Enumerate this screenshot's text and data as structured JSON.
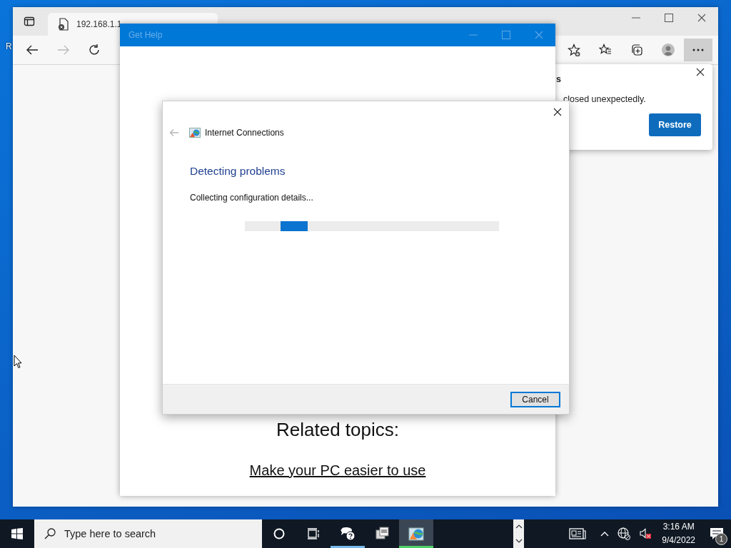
{
  "desktop": {
    "icon_labels": [
      "R"
    ]
  },
  "browser": {
    "tabs": [
      {
        "label": "192.168.1.1",
        "selected": true
      }
    ],
    "forward_disabled": true,
    "restore_popup": {
      "title": "s",
      "message": "closed unexpectedly.",
      "button": "Restore"
    }
  },
  "get_help": {
    "title": "Get Help",
    "heading": "Related topics:",
    "links": [
      "Make your PC easier to use"
    ]
  },
  "troubleshooter": {
    "title": "Internet Connections",
    "back_disabled": true,
    "heading": "Detecting problems",
    "status": "Collecting configuration details...",
    "progress": {
      "indeterminate": true
    },
    "buttons": [
      {
        "label": "Cancel",
        "default": true
      }
    ]
  },
  "taskbar": {
    "search": {
      "placeholder": "Type here to search"
    },
    "apps": [
      {
        "kind": "help",
        "running": true,
        "selected": false
      },
      {
        "kind": "drive",
        "running": false,
        "selected": false
      },
      {
        "kind": "network",
        "running": true,
        "selected": true
      }
    ],
    "clock": {
      "time": "3:16 AM",
      "date": "9/4/2022"
    },
    "notifications": {
      "count": "1"
    }
  }
}
